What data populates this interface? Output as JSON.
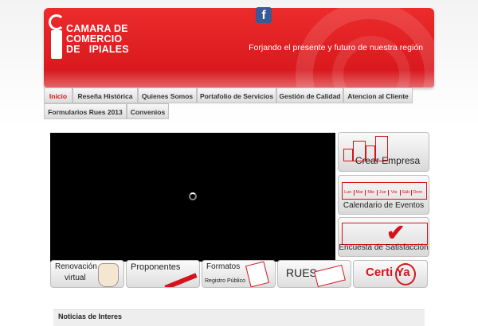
{
  "header": {
    "logo_line1": "CAMARA DE",
    "logo_line2": "COMERCIO",
    "logo_line3": "DE   IPIALES",
    "tagline": "Forjando el presente y futuro de nuestra región",
    "facebook_icon": "facebook-icon",
    "brand_color": "#d4141a"
  },
  "nav": {
    "tabs": [
      {
        "label": "Inicio",
        "active": true
      },
      {
        "label": "Reseña Histórica"
      },
      {
        "label": "Quienes Somos"
      },
      {
        "label": "Portafolio de Servicios"
      },
      {
        "label": "Gestión de Calidad"
      },
      {
        "label": "Atencion al Cliente"
      },
      {
        "label": "Formularios Rues 2013"
      },
      {
        "label": "Convenios"
      }
    ]
  },
  "video": {
    "icon": "loading-spinner-icon"
  },
  "side_buttons": [
    {
      "label": "Crear Empresa",
      "icon": "buildings-icon"
    },
    {
      "label": "Calendario de Eventos",
      "icon": "calendar-icon"
    },
    {
      "label": "Encuesta de Satisfacción",
      "icon": "checkmark-icon"
    }
  ],
  "calendar_days": [
    "Lun",
    "Mar",
    "Mie",
    "Jue",
    "Vie",
    "Sáb",
    "Dom"
  ],
  "bottom_buttons": [
    {
      "line1": "Renovación",
      "line2": "virtual",
      "icon": "hand-pointer-icon"
    },
    {
      "line1": "Proponentes",
      "line2": "",
      "icon": "pen-icon"
    },
    {
      "line1": "Formatos",
      "line2": "Registro Público",
      "icon": "document-icon"
    },
    {
      "line1": "RUES",
      "line2": "",
      "icon": "stamp-icon"
    },
    {
      "line1": "Certi Ya",
      "line2": "",
      "icon": "certificate-icon"
    }
  ],
  "news": {
    "title": "Noticias de Interes"
  }
}
